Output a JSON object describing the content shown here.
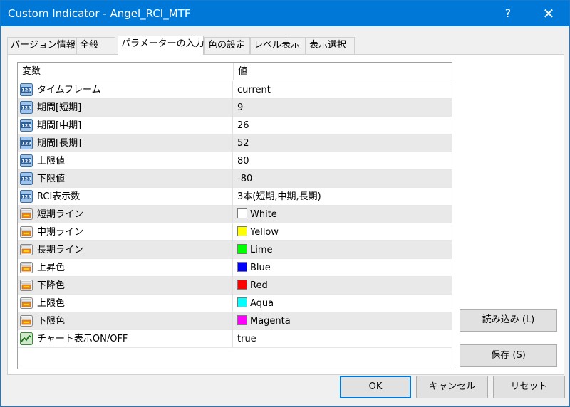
{
  "window": {
    "title": "Custom Indicator - Angel_RCI_MTF",
    "help_label": "?",
    "close_label": "✕"
  },
  "tabs": [
    {
      "label": "パージョン情報"
    },
    {
      "label": "全般"
    },
    {
      "label": "パラメーターの入力",
      "active": true
    },
    {
      "label": "色の設定"
    },
    {
      "label": "レベル表示"
    },
    {
      "label": "表示選択"
    }
  ],
  "grid": {
    "headers": {
      "name": "変数",
      "value": "値"
    },
    "rows": [
      {
        "icon": "numeric-123-icon",
        "name": "タイムフレーム",
        "value": "current"
      },
      {
        "icon": "numeric-123-icon",
        "name": "期間[短期]",
        "value": "9"
      },
      {
        "icon": "numeric-123-icon",
        "name": "期間[中期]",
        "value": "26"
      },
      {
        "icon": "numeric-123-icon",
        "name": "期間[長期]",
        "value": "52"
      },
      {
        "icon": "numeric-123-icon",
        "name": "上限値",
        "value": "80"
      },
      {
        "icon": "numeric-123-icon",
        "name": "下限値",
        "value": "-80"
      },
      {
        "icon": "numeric-123-icon",
        "name": "RCI表示数",
        "value": "3本(短期,中期,長期)"
      },
      {
        "icon": "color-palette-icon",
        "name": "短期ライン",
        "value": "White",
        "color": "#ffffff"
      },
      {
        "icon": "color-palette-icon",
        "name": "中期ライン",
        "value": "Yellow",
        "color": "#ffff00"
      },
      {
        "icon": "color-palette-icon",
        "name": "長期ライン",
        "value": "Lime",
        "color": "#00ff00"
      },
      {
        "icon": "color-palette-icon",
        "name": "上昇色",
        "value": "Blue",
        "color": "#0000ff"
      },
      {
        "icon": "color-palette-icon",
        "name": "下降色",
        "value": "Red",
        "color": "#ff0000"
      },
      {
        "icon": "color-palette-icon",
        "name": "上限色",
        "value": "Aqua",
        "color": "#00ffff"
      },
      {
        "icon": "color-palette-icon",
        "name": "下限色",
        "value": "Magenta",
        "color": "#ff00ff"
      },
      {
        "icon": "boolean-chart-icon",
        "name": "チャート表示ON/OFF",
        "value": "true"
      }
    ]
  },
  "side_buttons": {
    "load_label": "読み込み (L)",
    "save_label": "保存 (S)"
  },
  "footer": {
    "ok_label": "OK",
    "cancel_label": "キャンセル",
    "reset_label": "リセット"
  },
  "colors": {
    "titlebar": "#0078d7",
    "accent": "#0078d7",
    "row_alt": "#e9e9e9"
  }
}
